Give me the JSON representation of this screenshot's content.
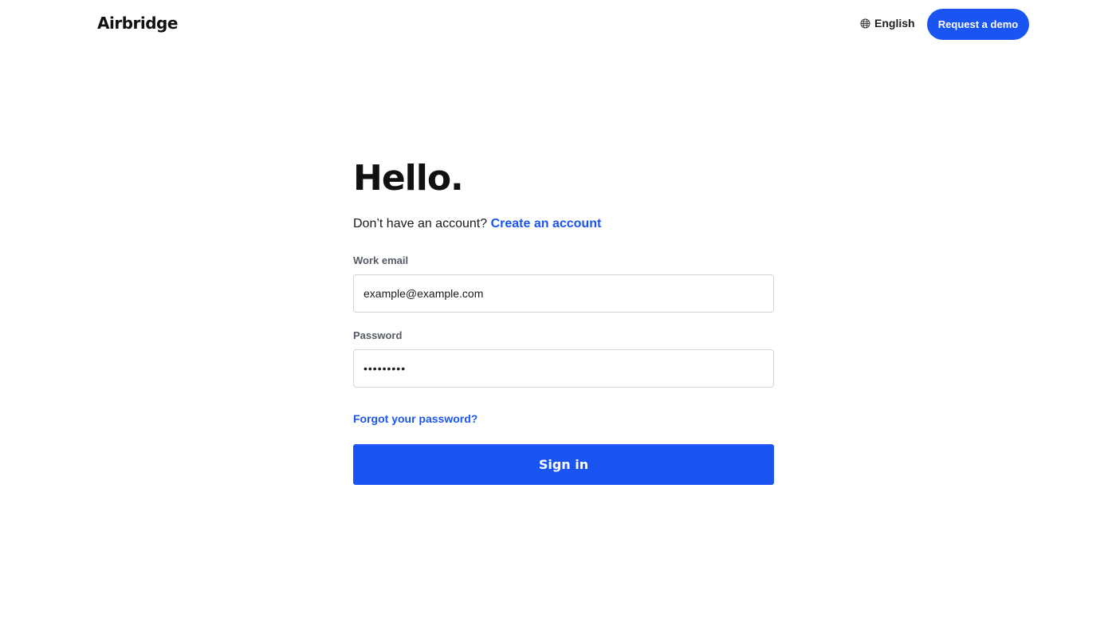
{
  "header": {
    "logo_text": "Airbridge",
    "language_label": "English",
    "language_icon": "globe-icon",
    "demo_button_label": "Request a demo"
  },
  "form": {
    "title": "Hello.",
    "signup_prompt": "Don’t have an account?",
    "signup_link": "Create an account",
    "email_label": "Work email",
    "email_placeholder": "example@example.com",
    "email_value": "",
    "password_label": "Password",
    "password_value": "password1",
    "forgot_link": "Forgot your password?",
    "signin_button": "Sign in"
  },
  "colors": {
    "accent": "#1a55f3",
    "text": "#1a1a1a",
    "label": "#555b66",
    "border": "#cfd3da"
  }
}
